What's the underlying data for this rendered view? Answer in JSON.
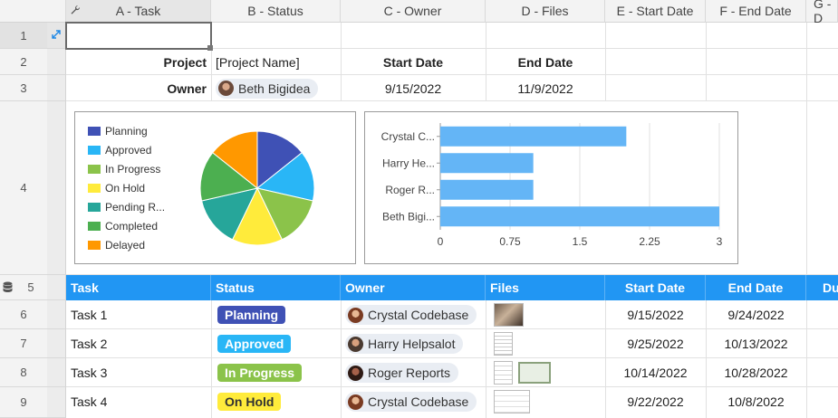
{
  "columns": [
    {
      "label": "A - Task"
    },
    {
      "label": "B - Status"
    },
    {
      "label": "C - Owner"
    },
    {
      "label": "D - Files"
    },
    {
      "label": "E - Start Date"
    },
    {
      "label": "F - End Date"
    },
    {
      "label": "G - D"
    }
  ],
  "rows": [
    "1",
    "2",
    "3",
    "4",
    "5",
    "6",
    "7",
    "8",
    "9"
  ],
  "project_row": {
    "project_label": "Project",
    "project_name": "[Project Name]",
    "start_label": "Start Date",
    "end_label": "End Date"
  },
  "owner_row": {
    "owner_label": "Owner",
    "owner_name": "Beth Bigidea",
    "start_date": "9/15/2022",
    "end_date": "11/9/2022"
  },
  "table_header": {
    "task": "Task",
    "status": "Status",
    "owner": "Owner",
    "files": "Files",
    "start": "Start Date",
    "end": "End Date",
    "dur": "Du"
  },
  "tasks": [
    {
      "task": "Task 1",
      "status": "Planning",
      "owner": "Crystal Codebase",
      "start": "9/15/2022",
      "end": "9/24/2022"
    },
    {
      "task": "Task 2",
      "status": "Approved",
      "owner": "Harry Helpsalot",
      "start": "9/25/2022",
      "end": "10/13/2022"
    },
    {
      "task": "Task 3",
      "status": "In Progress",
      "owner": "Roger Reports",
      "start": "10/14/2022",
      "end": "10/28/2022"
    },
    {
      "task": "Task 4",
      "status": "On Hold",
      "owner": "Crystal Codebase",
      "start": "9/22/2022",
      "end": "10/8/2022"
    }
  ],
  "colors": {
    "accent": "#2196f3",
    "planning": "#3f51b5",
    "approved": "#29b6f6",
    "in_progress": "#8bc34a",
    "on_hold": "#ffeb3b",
    "pending": "#26a69a",
    "completed": "#4caf50",
    "delayed": "#ff9800"
  },
  "chart_data": [
    {
      "type": "pie",
      "categories": [
        "Planning",
        "Approved",
        "In Progress",
        "On Hold",
        "Pending R...",
        "Completed",
        "Delayed"
      ],
      "values": [
        1,
        1,
        1,
        1,
        1,
        1,
        1
      ],
      "colors": [
        "#3f51b5",
        "#29b6f6",
        "#8bc34a",
        "#ffeb3b",
        "#26a69a",
        "#4caf50",
        "#ff9800"
      ],
      "legend_position": "left"
    },
    {
      "type": "bar",
      "orientation": "horizontal",
      "categories": [
        "Crystal C...",
        "Harry He...",
        "Roger R...",
        "Beth Bigi..."
      ],
      "values": [
        2,
        1,
        1,
        3
      ],
      "xlim": [
        0,
        3
      ],
      "xticks": [
        "0",
        "0.75",
        "1.5",
        "2.25",
        "3"
      ],
      "color": "#64b5f6",
      "grid": true
    }
  ]
}
